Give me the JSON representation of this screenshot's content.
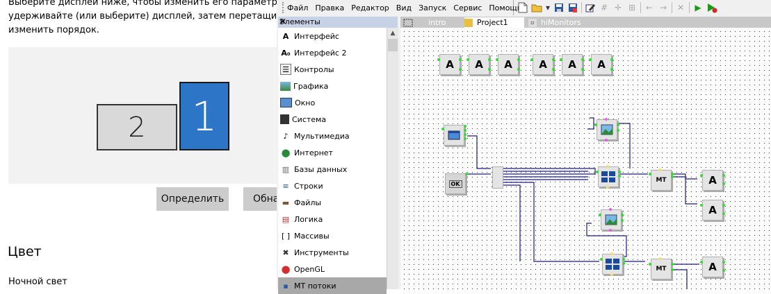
{
  "settings": {
    "desc_line1": "Выберите дисплей ниже, чтобы изменить его параметры. На",
    "desc_line2": "удерживайте (или выберите) дисплей, затем перетащите его",
    "desc_line3": "изменить порядок.",
    "monitor1": "1",
    "monitor2": "2",
    "identify_button": "Определить",
    "detect_button": "Обна",
    "color_heading": "Цвет",
    "night_light": "Ночной свет"
  },
  "menu": [
    "Файл",
    "Правка",
    "Редактор",
    "Вид",
    "Запуск",
    "Сервис",
    "Помощь"
  ],
  "toolbar_icons": [
    "new-file-icon",
    "open-folder-icon",
    "dropdown-arrow-icon",
    "save-icon",
    "save-as-icon",
    "edit-icon",
    "grid-icon",
    "center-icon",
    "align-icon",
    "undo-icon",
    "redo-icon",
    "delete-icon",
    "run-icon",
    "debug-run-icon"
  ],
  "elements_panel": {
    "title": "Элементы",
    "items": [
      {
        "label": "Интерфейс",
        "icon": "A"
      },
      {
        "label": "Интерфейс 2",
        "icon": "A₀"
      },
      {
        "label": "Контролы",
        "icon": "☰"
      },
      {
        "label": "Графика",
        "icon": "▣"
      },
      {
        "label": "Окно",
        "icon": "▭"
      },
      {
        "label": "Система",
        "icon": "◪"
      },
      {
        "label": "Мультимедиа",
        "icon": "♪"
      },
      {
        "label": "Интернет",
        "icon": "●"
      },
      {
        "label": "Базы данных",
        "icon": "▥"
      },
      {
        "label": "Строки",
        "icon": "≡"
      },
      {
        "label": "Файлы",
        "icon": "▬"
      },
      {
        "label": "Логика",
        "icon": "▤"
      },
      {
        "label": "Массивы",
        "icon": "[ ]"
      },
      {
        "label": "Инструменты",
        "icon": "✖"
      },
      {
        "label": "OpenGL",
        "icon": "●"
      },
      {
        "label": "МТ потоки",
        "icon": "▪"
      }
    ]
  },
  "tabs": [
    {
      "label": "intro",
      "active": false
    },
    {
      "label": "Project1",
      "active": true
    },
    {
      "label": "hiMonitors",
      "active": false
    }
  ],
  "canvas": {
    "label_glyph": "A",
    "ok_button": "OK",
    "mt_label": "MT"
  },
  "colors": {
    "accent": "#2d76c7",
    "wire": "#1a1a7a",
    "pin": "#33dd33",
    "panel_head": "#c8d2e6"
  }
}
